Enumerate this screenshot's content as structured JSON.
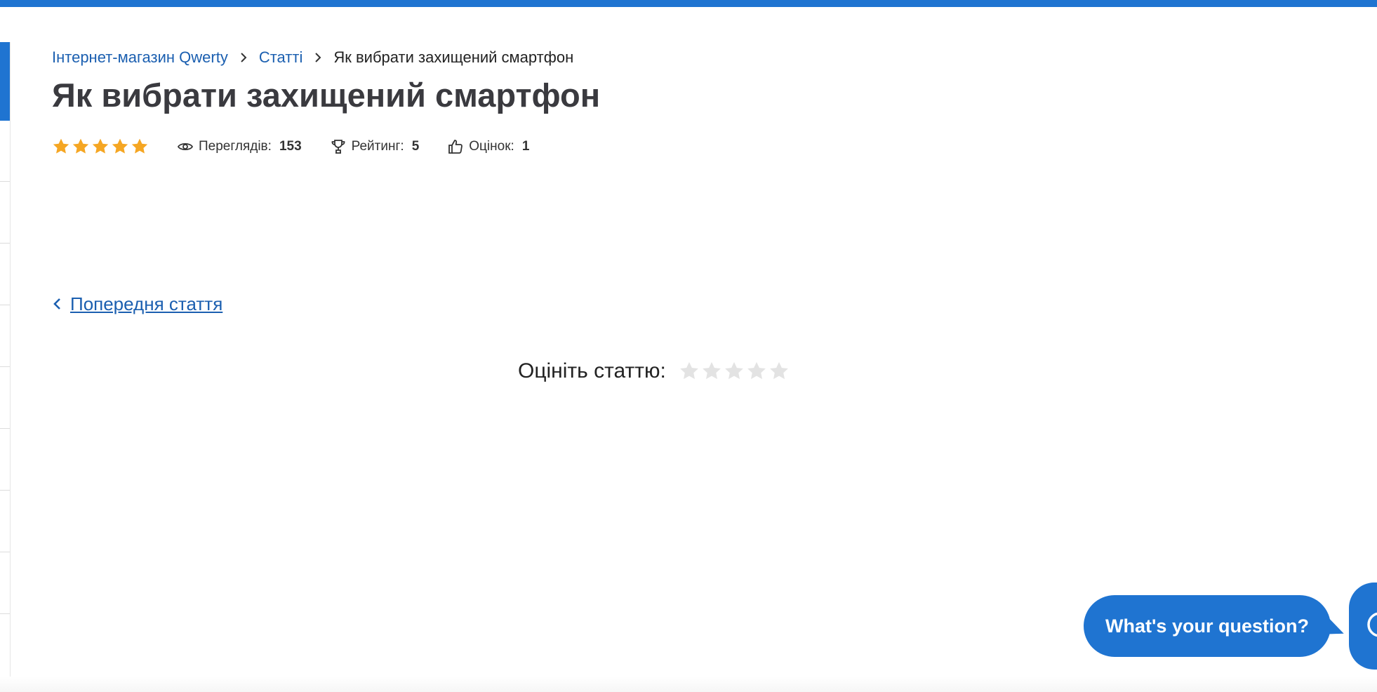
{
  "breadcrumb": {
    "items": [
      {
        "label": "Інтернет-магазин Qwerty"
      },
      {
        "label": "Статті"
      }
    ],
    "current": "Як вибрати захищений смартфон"
  },
  "article": {
    "title": "Як вибрати захищений смартфон",
    "star_rating": 5,
    "views_label": "Переглядів:",
    "views_value": "153",
    "rating_label": "Рейтинг:",
    "rating_value": "5",
    "votes_label": "Оцінок:",
    "votes_value": "1"
  },
  "navigation": {
    "prev_label": "Попередня стаття"
  },
  "rate": {
    "label": "Оцініть статтю:",
    "selected": 0,
    "max": 5
  },
  "chat": {
    "bubble_text": "What's your question?"
  },
  "colors": {
    "accent": "#1f74d1",
    "link": "#1b5fb0",
    "star_filled": "#f5a623",
    "star_empty": "#e3e3e3",
    "title": "#3a3a3f"
  },
  "icons": {
    "views": "eye-icon",
    "rating": "trophy-icon",
    "votes": "thumbs-up-icon",
    "breadcrumb_separator": "chevron-right-icon",
    "prev": "chevron-left-icon",
    "chat": "chat-icon"
  }
}
